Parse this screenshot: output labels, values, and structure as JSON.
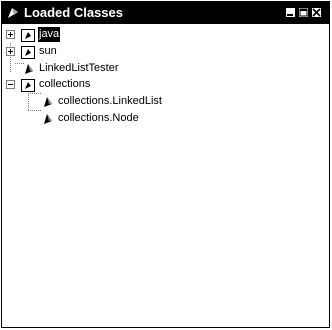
{
  "window": {
    "title": "Loaded Classes",
    "icon": "class-tree-icon",
    "buttons": [
      "minimize-icon",
      "maximize-icon",
      "close-icon"
    ]
  },
  "tree": {
    "items": [
      {
        "label": "java",
        "type": "package",
        "expanded": false,
        "selected": true,
        "level": 0
      },
      {
        "label": "sun",
        "type": "package",
        "expanded": false,
        "selected": false,
        "level": 0
      },
      {
        "label": "LinkedListTester",
        "type": "class",
        "selected": false,
        "level": 0
      },
      {
        "label": "collections",
        "type": "package",
        "expanded": true,
        "selected": false,
        "level": 0
      },
      {
        "label": "collections.LinkedList",
        "type": "class",
        "selected": false,
        "level": 1
      },
      {
        "label": "collections.Node",
        "type": "class",
        "selected": false,
        "level": 1
      }
    ]
  }
}
